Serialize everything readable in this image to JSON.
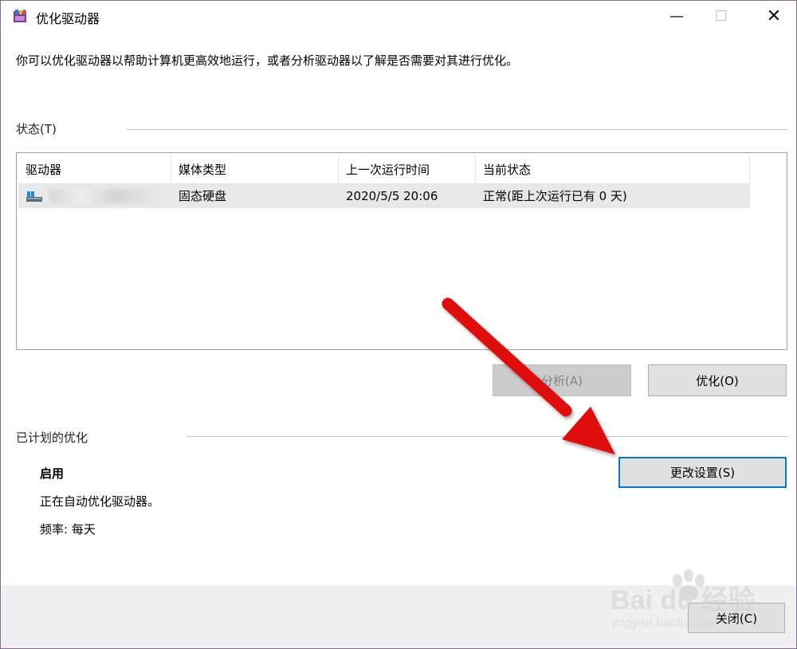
{
  "window": {
    "title": "优化驱动器",
    "controls": {
      "minimize": "—",
      "maximize": "☐",
      "close": "✕"
    }
  },
  "description": "你可以优化驱动器以帮助计算机更高效地运行，或者分析驱动器以了解是否需要对其进行优化。",
  "status_group": {
    "label": "状态(T)",
    "columns": [
      "驱动器",
      "媒体类型",
      "上一次运行时间",
      "当前状态"
    ],
    "rows": [
      {
        "icon": "drive-icon",
        "drive": "",
        "media_type": "固态硬盘",
        "last_run": "2020/5/5 20:06",
        "status": "正常(距上次运行已有 0 天)"
      }
    ]
  },
  "buttons": {
    "analyze": "分析(A)",
    "optimize": "优化(O)",
    "change_settings": "更改设置(S)",
    "close": "关闭(C)"
  },
  "scheduled_group": {
    "label": "已计划的优化",
    "state": "启用",
    "detail": "正在自动优化驱动器。",
    "frequency": "频率: 每天"
  },
  "watermark": {
    "brand": "Bai du 经验",
    "url": "jingyan.baidu.com"
  },
  "colors": {
    "annotation_arrow": "#e01010",
    "focus_border": "#0078d7",
    "window_border": "#8a6a9a"
  }
}
